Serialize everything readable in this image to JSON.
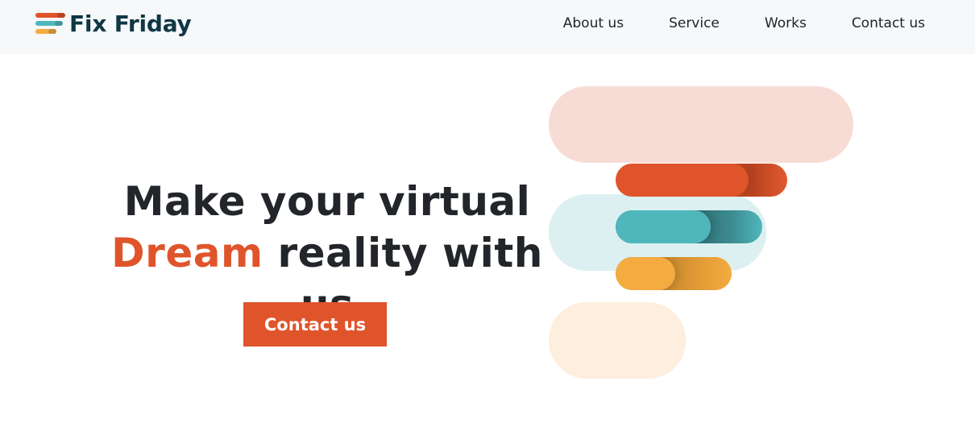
{
  "brand": {
    "name": "Fix Friday",
    "colors": {
      "primary": "#e0542b",
      "teal": "#4fb7bc",
      "yellow": "#f4ab40",
      "dark": "#0f3745"
    }
  },
  "nav": {
    "items": [
      {
        "label": "About us"
      },
      {
        "label": "Service"
      },
      {
        "label": "Works"
      },
      {
        "label": "Contact us"
      }
    ]
  },
  "hero": {
    "title_line1": "Make your virtual",
    "title_accent": "Dream",
    "title_line2_rest": " reality with us",
    "cta_label": "Contact us"
  }
}
